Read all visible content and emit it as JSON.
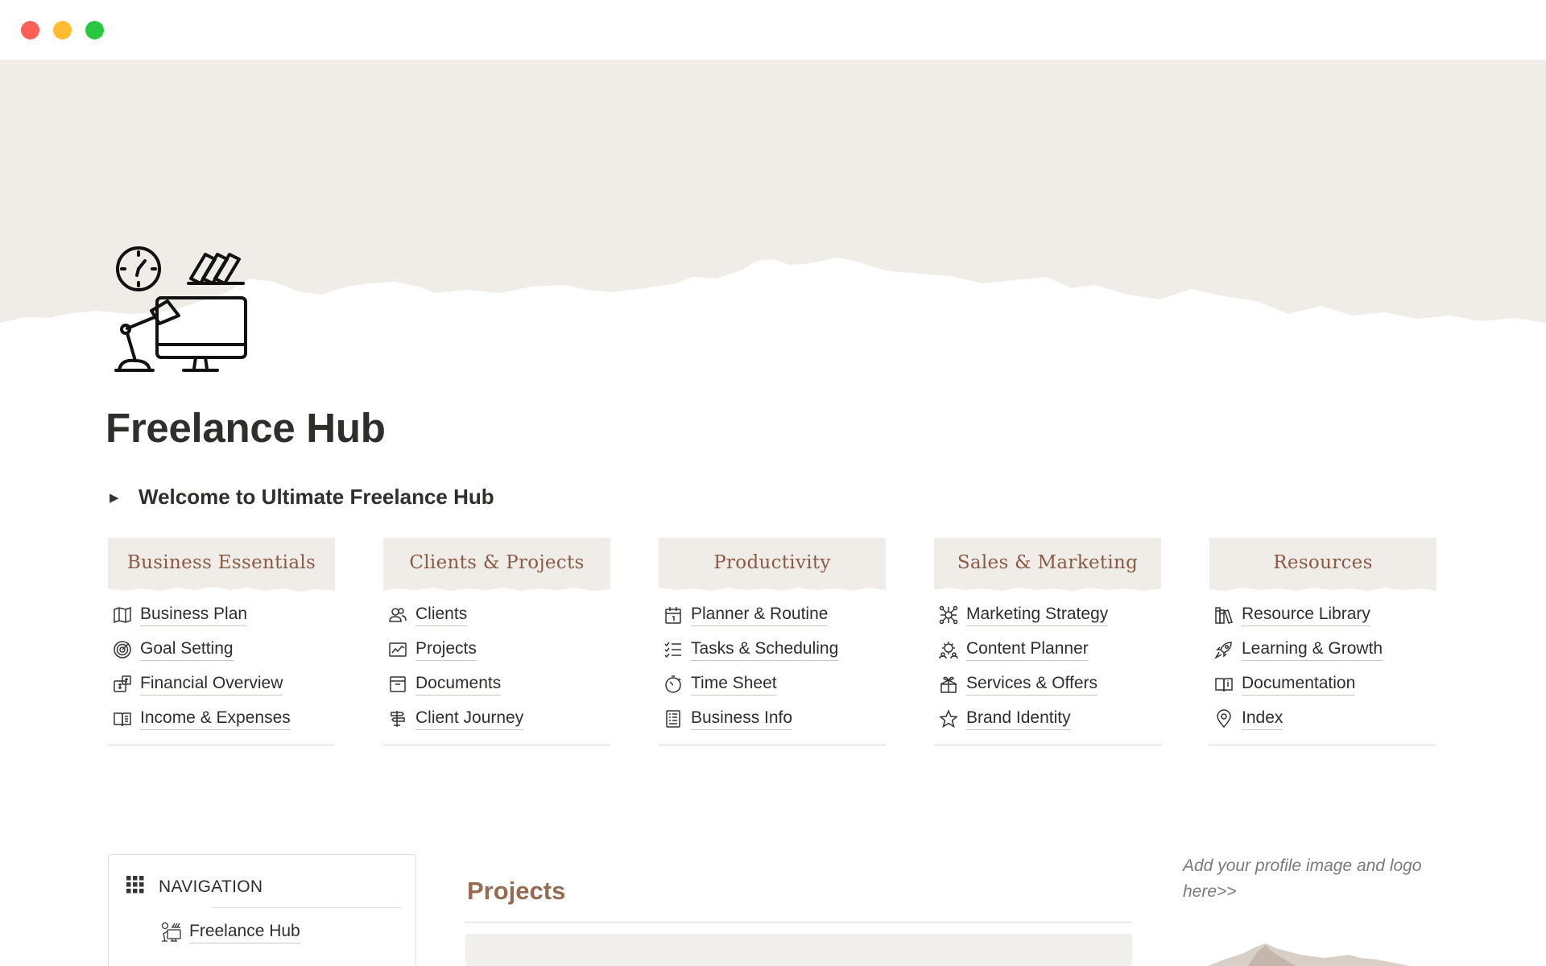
{
  "window": {
    "controls": [
      "close",
      "minimize",
      "zoom"
    ]
  },
  "page": {
    "title": "Freelance Hub",
    "icon": "desk-workspace-icon",
    "toggle": {
      "label": "Welcome to Ultimate Freelance Hub",
      "state": "collapsed"
    }
  },
  "colors": {
    "cover": "#f0ede8",
    "accent": "#8a5a44",
    "projects_heading": "#956b52",
    "text": "#2f2e2a"
  },
  "columns": [
    {
      "title": "Business Essentials",
      "items": [
        {
          "label": "Business Plan",
          "icon": "map-icon"
        },
        {
          "label": "Goal Setting",
          "icon": "target-icon"
        },
        {
          "label": "Financial Overview",
          "icon": "money-icon"
        },
        {
          "label": "Income & Expenses",
          "icon": "ledger-icon"
        }
      ]
    },
    {
      "title": "Clients & Projects",
      "items": [
        {
          "label": "Clients",
          "icon": "users-icon"
        },
        {
          "label": "Projects",
          "icon": "chart-board-icon"
        },
        {
          "label": "Documents",
          "icon": "archive-box-icon"
        },
        {
          "label": "Client Journey",
          "icon": "signpost-icon"
        }
      ]
    },
    {
      "title": "Productivity",
      "items": [
        {
          "label": "Planner & Routine",
          "icon": "calendar-icon"
        },
        {
          "label": "Tasks & Scheduling",
          "icon": "checklist-icon"
        },
        {
          "label": "Time Sheet",
          "icon": "stopwatch-icon"
        },
        {
          "label": "Business Info",
          "icon": "document-icon"
        }
      ]
    },
    {
      "title": "Sales & Marketing",
      "items": [
        {
          "label": "Marketing Strategy",
          "icon": "network-gear-icon"
        },
        {
          "label": "Content Planner",
          "icon": "gear-people-icon"
        },
        {
          "label": "Services & Offers",
          "icon": "gift-box-icon"
        },
        {
          "label": "Brand Identity",
          "icon": "star-icon"
        }
      ]
    },
    {
      "title": "Resources",
      "items": [
        {
          "label": "Resource Library",
          "icon": "books-icon"
        },
        {
          "label": "Learning & Growth",
          "icon": "rocket-icon"
        },
        {
          "label": "Documentation",
          "icon": "open-book-icon"
        },
        {
          "label": "Index",
          "icon": "map-pin-icon"
        }
      ]
    }
  ],
  "navigation": {
    "title": "NAVIGATION",
    "icon": "grid-icon",
    "items": [
      {
        "label": "Freelance Hub",
        "icon": "desk-workspace-icon"
      }
    ]
  },
  "projects": {
    "title": "Projects"
  },
  "profile": {
    "hint": "Add your profile image and logo here>>"
  }
}
